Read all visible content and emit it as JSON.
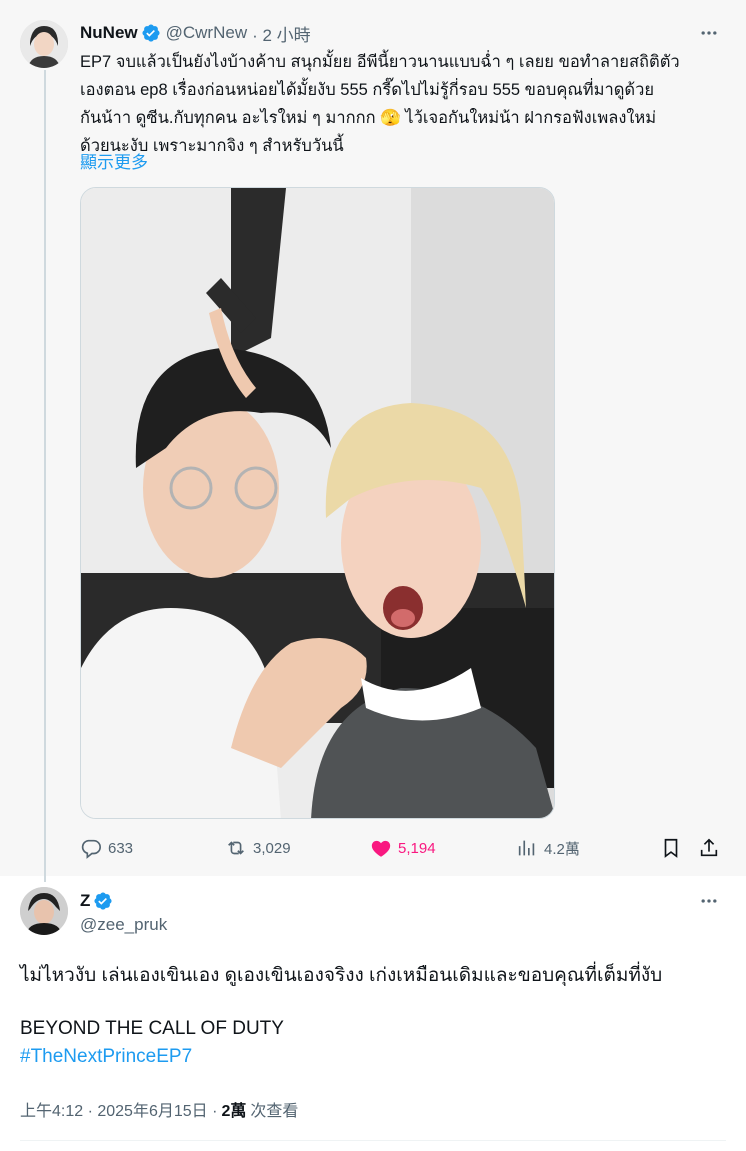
{
  "parent_tweet": {
    "name": "NuNew",
    "handle": "@CwrNew",
    "time": "· 2 小時",
    "text_lines": [
      "EP7 จบแล้วเป็นยังไงบ้างค้าบ สนุกมั้ยย อีพีนี้ยาวนานแบบฉ่ำ ๆ เลยย ขอทำลายสถิติตัว",
      "เองตอน ep8 เรื่องก่อนหน่อยได้มั้ยงับ 555 กรี๊ดไปไม่รู้กี่รอบ 555 ขอบคุณที่มาดูด้วย",
      "กันน้าา ดูซีน.กับทุกคน อะไรใหม่ ๆ มากกก 🫣 ไว้เจอกันใหม่น้า ฝากรอฟังเพลงใหม่",
      "ด้วยนะงับ เพราะมากจิง ๆ สำหรับวันนี้"
    ],
    "show_more": "顯示更多",
    "stats": {
      "replies": "633",
      "retweets": "3,029",
      "likes": "5,194",
      "views": "4.2萬"
    }
  },
  "reply_tweet": {
    "name": "Z",
    "handle": "@zee_pruk",
    "text": "ไม่ไหวงับ เล่นเองเขินเอง ดูเองเขินเองจริงง  เก่งเหมือนเดิมและขอบคุณที่เต็มที่งับ",
    "text2": "BEYOND THE CALL OF DUTY",
    "hashtag": "#TheNextPrinceEP7",
    "timestamp": "上午4:12 · 2025年6月15日 ·",
    "views_count": "2萬",
    "views_label": "次查看"
  },
  "colors": {
    "accent": "#1d9bf0",
    "like": "#f91880",
    "muted": "#536471",
    "text": "#0f1419"
  },
  "icons": [
    "verified-badge-icon",
    "more-icon",
    "reply-icon",
    "retweet-icon",
    "heart-icon",
    "views-icon",
    "bookmark-icon",
    "share-icon"
  ]
}
